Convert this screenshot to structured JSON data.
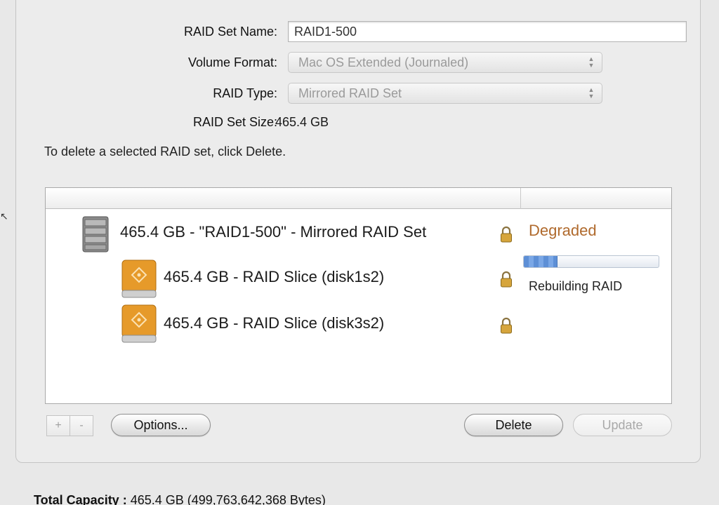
{
  "form": {
    "raid_set_name_label": "RAID Set Name:",
    "raid_set_name_value": "RAID1-500",
    "volume_format_label": "Volume Format:",
    "volume_format_value": "Mac OS Extended (Journaled)",
    "raid_type_label": "RAID Type:",
    "raid_type_value": "Mirrored RAID Set",
    "raid_set_size_label": "RAID Set Size:",
    "raid_set_size_value": "465.4 GB"
  },
  "info_text": "To delete a selected RAID set, click Delete.",
  "list": {
    "rows": [
      {
        "label": "465.4 GB - \"RAID1-500\" - Mirrored RAID Set",
        "status": "Degraded"
      },
      {
        "label": "465.4 GB - RAID Slice (disk1s2)",
        "status": "Rebuilding RAID",
        "progress": 0.25
      },
      {
        "label": "465.4 GB - RAID Slice (disk3s2)",
        "status": ""
      }
    ]
  },
  "buttons": {
    "add": "+",
    "remove": "-",
    "options": "Options...",
    "delete": "Delete",
    "update": "Update"
  },
  "footer": {
    "label": "Total Capacity :",
    "value": "465.4 GB (499,763,642,368 Bytes)"
  },
  "icons": [
    "raid-set-icon",
    "disk-icon",
    "lock-icon",
    "popup-arrows-icon"
  ],
  "colors": {
    "degraded": "#b06a2d",
    "progress": "#5d8fd6"
  }
}
